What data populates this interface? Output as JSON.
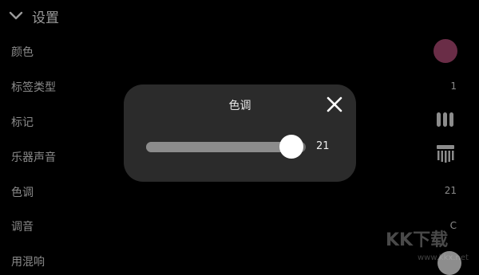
{
  "header": {
    "title": "设置"
  },
  "settings": [
    {
      "label": "颜色"
    },
    {
      "label": "标签类型",
      "value": "1"
    },
    {
      "label": "标记"
    },
    {
      "label": "乐器声音"
    },
    {
      "label": "色调",
      "value": "21"
    },
    {
      "label": "调音",
      "value": "C"
    },
    {
      "label": "用混响"
    }
  ],
  "swatch_color": "#6a2d47",
  "dialog": {
    "title": "色调",
    "slider": {
      "value": "21",
      "fraction": 0.91
    }
  },
  "watermark": {
    "text": "KK下载",
    "url": "www.kkx.net"
  }
}
